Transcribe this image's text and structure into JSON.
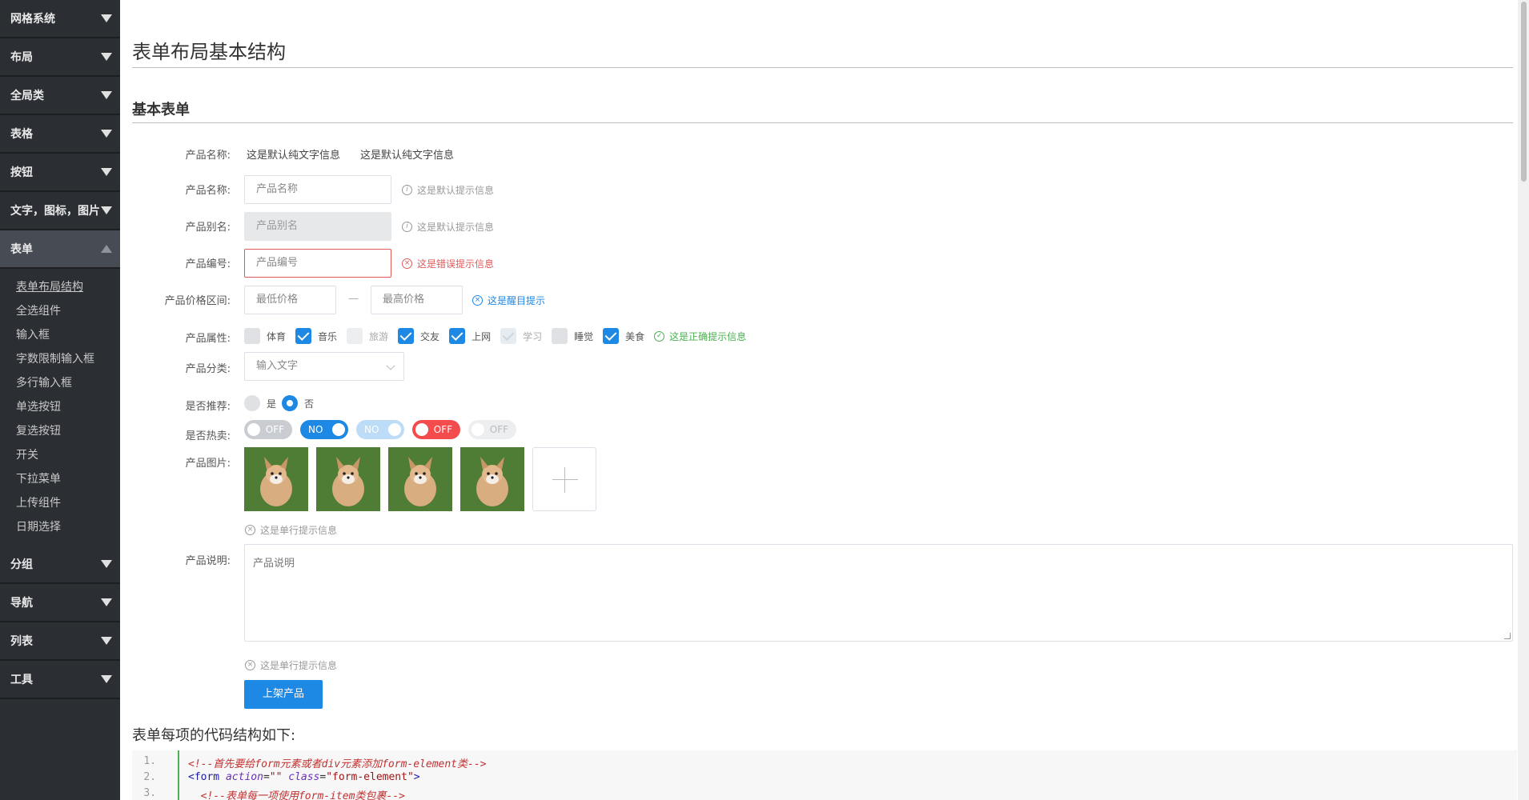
{
  "sidebar": {
    "groups_top": [
      "网格系统",
      "布局",
      "全局类",
      "表格",
      "按钮",
      "文字，图标，图片"
    ],
    "active_group": "表单",
    "sub_items": [
      "表单布局结构",
      "全选组件",
      "输入框",
      "字数限制输入框",
      "多行输入框",
      "单选按钮",
      "复选按钮",
      "开关",
      "下拉菜单",
      "上传组件",
      "日期选择"
    ],
    "groups_bottom": [
      "分组",
      "导航",
      "列表",
      "工具"
    ]
  },
  "main": {
    "page_title": "表单布局基本结构",
    "section_title": "基本表单",
    "form": {
      "row1": {
        "label": "产品名称:",
        "text1": "这是默认纯文字信息",
        "text2": "这是默认纯文字信息"
      },
      "row2": {
        "label": "产品名称:",
        "placeholder": "产品名称",
        "hint": "这是默认提示信息"
      },
      "row3": {
        "label": "产品别名:",
        "placeholder": "产品别名",
        "hint": "这是默认提示信息"
      },
      "row4": {
        "label": "产品编号:",
        "placeholder": "产品编号",
        "hint": "这是错误提示信息"
      },
      "row5": {
        "label": "产品价格区间:",
        "min_placeholder": "最低价格",
        "max_placeholder": "最高价格",
        "separator": "—",
        "hint": "这是醒目提示"
      },
      "row6": {
        "label": "产品属性:",
        "options": [
          "体育",
          "音乐",
          "旅游",
          "交友",
          "上网",
          "学习",
          "睡觉",
          "美食"
        ],
        "hint": "这是正确提示信息"
      },
      "row7": {
        "label": "产品分类:",
        "placeholder": "输入文字"
      },
      "row8": {
        "label": "是否推荐:",
        "yes": "是",
        "no": "否"
      },
      "row9": {
        "label": "是否热卖:",
        "switches": [
          "OFF",
          "NO",
          "NO",
          "OFF",
          "OFF"
        ]
      },
      "row10": {
        "label": "产品图片:",
        "hint": "这是单行提示信息"
      },
      "row11": {
        "label": "产品说明:",
        "placeholder": "产品说明",
        "hint": "这是单行提示信息"
      },
      "submit": "上架产品"
    },
    "code_title": "表单每项的代码结构如下:",
    "code": {
      "lines": [
        "1.",
        "2.",
        "3."
      ],
      "l1_comment": "<!--首先要给form元素或者div元素添加form-element类-->",
      "l2_open": "<form",
      "l2_attr1": " action",
      "l2_eq1": "=",
      "l2_val1": "\"\"",
      "l2_attr2": " class",
      "l2_eq2": "=",
      "l2_val2": "\"form-element\"",
      "l2_close": ">",
      "l3_comment": "  <!--表单每一项使用form-item类包裹-->"
    }
  },
  "colors": {
    "accent": "#1e88e5",
    "error": "#e05a5a",
    "success": "#4caf50",
    "sidebar": "#2b2e33"
  }
}
